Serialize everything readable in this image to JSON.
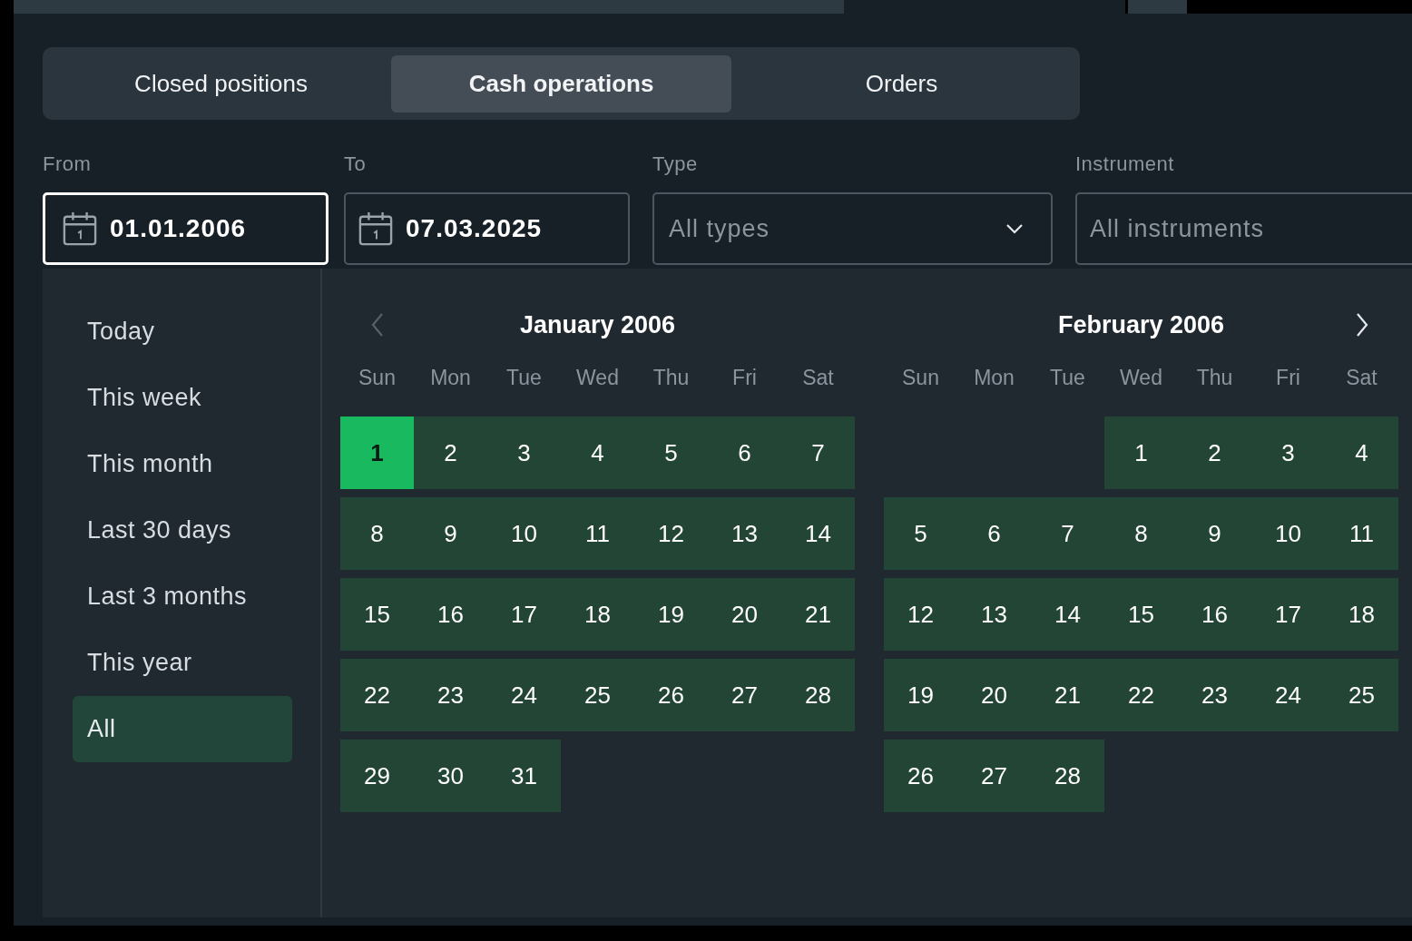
{
  "tabs": [
    {
      "label": "Closed positions",
      "selected": false
    },
    {
      "label": "Cash operations",
      "selected": true
    },
    {
      "label": "Orders",
      "selected": false
    }
  ],
  "filters": [
    {
      "kind": "date",
      "label": "From",
      "value": "01.01.2006",
      "focused": true
    },
    {
      "kind": "date",
      "label": "To",
      "value": "07.03.2025",
      "focused": false
    },
    {
      "kind": "select",
      "label": "Type",
      "placeholder": "All types",
      "focused": false
    },
    {
      "kind": "text",
      "label": "Instrument",
      "placeholder": "All instruments",
      "focused": false
    }
  ],
  "presets": [
    {
      "label": "Today",
      "selected": false
    },
    {
      "label": "This week",
      "selected": false
    },
    {
      "label": "This month",
      "selected": false
    },
    {
      "label": "Last 30 days",
      "selected": false
    },
    {
      "label": "Last 3 months",
      "selected": false
    },
    {
      "label": "This year",
      "selected": false
    },
    {
      "label": "All",
      "selected": true
    }
  ],
  "calendars": [
    {
      "title": "January 2006",
      "nav": {
        "kind": "prev",
        "disabled": true
      },
      "weekdays": [
        "Sun",
        "Mon",
        "Tue",
        "Wed",
        "Thu",
        "Fri",
        "Sat"
      ],
      "weeks": [
        [
          {
            "kind": "day",
            "label": "1",
            "selected": true,
            "in_range": true
          },
          {
            "kind": "day",
            "label": "2",
            "selected": false,
            "in_range": true
          },
          {
            "kind": "day",
            "label": "3",
            "selected": false,
            "in_range": true
          },
          {
            "kind": "day",
            "label": "4",
            "selected": false,
            "in_range": true
          },
          {
            "kind": "day",
            "label": "5",
            "selected": false,
            "in_range": true
          },
          {
            "kind": "day",
            "label": "6",
            "selected": false,
            "in_range": true
          },
          {
            "kind": "day",
            "label": "7",
            "selected": false,
            "in_range": true
          }
        ],
        [
          {
            "kind": "day",
            "label": "8",
            "selected": false,
            "in_range": true
          },
          {
            "kind": "day",
            "label": "9",
            "selected": false,
            "in_range": true
          },
          {
            "kind": "day",
            "label": "10",
            "selected": false,
            "in_range": true
          },
          {
            "kind": "day",
            "label": "11",
            "selected": false,
            "in_range": true
          },
          {
            "kind": "day",
            "label": "12",
            "selected": false,
            "in_range": true
          },
          {
            "kind": "day",
            "label": "13",
            "selected": false,
            "in_range": true
          },
          {
            "kind": "day",
            "label": "14",
            "selected": false,
            "in_range": true
          }
        ],
        [
          {
            "kind": "day",
            "label": "15",
            "selected": false,
            "in_range": true
          },
          {
            "kind": "day",
            "label": "16",
            "selected": false,
            "in_range": true
          },
          {
            "kind": "day",
            "label": "17",
            "selected": false,
            "in_range": true
          },
          {
            "kind": "day",
            "label": "18",
            "selected": false,
            "in_range": true
          },
          {
            "kind": "day",
            "label": "19",
            "selected": false,
            "in_range": true
          },
          {
            "kind": "day",
            "label": "20",
            "selected": false,
            "in_range": true
          },
          {
            "kind": "day",
            "label": "21",
            "selected": false,
            "in_range": true
          }
        ],
        [
          {
            "kind": "day",
            "label": "22",
            "selected": false,
            "in_range": true
          },
          {
            "kind": "day",
            "label": "23",
            "selected": false,
            "in_range": true
          },
          {
            "kind": "day",
            "label": "24",
            "selected": false,
            "in_range": true
          },
          {
            "kind": "day",
            "label": "25",
            "selected": false,
            "in_range": true
          },
          {
            "kind": "day",
            "label": "26",
            "selected": false,
            "in_range": true
          },
          {
            "kind": "day",
            "label": "27",
            "selected": false,
            "in_range": true
          },
          {
            "kind": "day",
            "label": "28",
            "selected": false,
            "in_range": true
          }
        ],
        [
          {
            "kind": "day",
            "label": "29",
            "selected": false,
            "in_range": true
          },
          {
            "kind": "day",
            "label": "30",
            "selected": false,
            "in_range": true
          },
          {
            "kind": "day",
            "label": "31",
            "selected": false,
            "in_range": true
          }
        ]
      ]
    },
    {
      "title": "February 2006",
      "nav": {
        "kind": "next",
        "disabled": false
      },
      "weekdays": [
        "Sun",
        "Mon",
        "Tue",
        "Wed",
        "Thu",
        "Fri",
        "Sat"
      ],
      "weeks": [
        [
          {
            "kind": "blank"
          },
          {
            "kind": "blank"
          },
          {
            "kind": "blank"
          },
          {
            "kind": "day",
            "label": "1",
            "selected": false,
            "in_range": true
          },
          {
            "kind": "day",
            "label": "2",
            "selected": false,
            "in_range": true
          },
          {
            "kind": "day",
            "label": "3",
            "selected": false,
            "in_range": true
          },
          {
            "kind": "day",
            "label": "4",
            "selected": false,
            "in_range": true
          }
        ],
        [
          {
            "kind": "day",
            "label": "5",
            "selected": false,
            "in_range": true
          },
          {
            "kind": "day",
            "label": "6",
            "selected": false,
            "in_range": true
          },
          {
            "kind": "day",
            "label": "7",
            "selected": false,
            "in_range": true
          },
          {
            "kind": "day",
            "label": "8",
            "selected": false,
            "in_range": true
          },
          {
            "kind": "day",
            "label": "9",
            "selected": false,
            "in_range": true
          },
          {
            "kind": "day",
            "label": "10",
            "selected": false,
            "in_range": true
          },
          {
            "kind": "day",
            "label": "11",
            "selected": false,
            "in_range": true
          }
        ],
        [
          {
            "kind": "day",
            "label": "12",
            "selected": false,
            "in_range": true
          },
          {
            "kind": "day",
            "label": "13",
            "selected": false,
            "in_range": true
          },
          {
            "kind": "day",
            "label": "14",
            "selected": false,
            "in_range": true
          },
          {
            "kind": "day",
            "label": "15",
            "selected": false,
            "in_range": true
          },
          {
            "kind": "day",
            "label": "16",
            "selected": false,
            "in_range": true
          },
          {
            "kind": "day",
            "label": "17",
            "selected": false,
            "in_range": true
          },
          {
            "kind": "day",
            "label": "18",
            "selected": false,
            "in_range": true
          }
        ],
        [
          {
            "kind": "day",
            "label": "19",
            "selected": false,
            "in_range": true
          },
          {
            "kind": "day",
            "label": "20",
            "selected": false,
            "in_range": true
          },
          {
            "kind": "day",
            "label": "21",
            "selected": false,
            "in_range": true
          },
          {
            "kind": "day",
            "label": "22",
            "selected": false,
            "in_range": true
          },
          {
            "kind": "day",
            "label": "23",
            "selected": false,
            "in_range": true
          },
          {
            "kind": "day",
            "label": "24",
            "selected": false,
            "in_range": true
          },
          {
            "kind": "day",
            "label": "25",
            "selected": false,
            "in_range": true
          }
        ],
        [
          {
            "kind": "day",
            "label": "26",
            "selected": false,
            "in_range": true
          },
          {
            "kind": "day",
            "label": "27",
            "selected": false,
            "in_range": true
          },
          {
            "kind": "day",
            "label": "28",
            "selected": false,
            "in_range": true
          }
        ]
      ]
    }
  ]
}
